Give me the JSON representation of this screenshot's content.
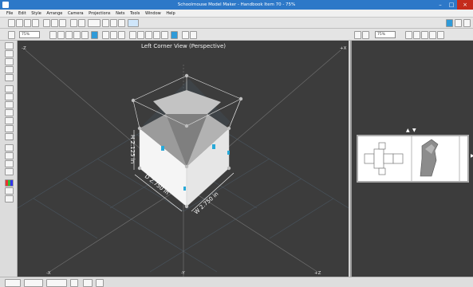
{
  "window": {
    "title": "Schoolmouse Model Maker - Handbook Item 70 - 75%"
  },
  "menu": [
    "File",
    "Edit",
    "Style",
    "Arrange",
    "Camera",
    "Projections",
    "Nets",
    "Tools",
    "Window",
    "Help"
  ],
  "toolbar": {
    "zoom_left": "75%",
    "zoom_right": "75%"
  },
  "viewport": {
    "view_title": "Left Corner View (Perspective)",
    "axis_labels": {
      "top_left": "-Z",
      "top_right": "+X",
      "bottom_left": "-X",
      "bottom_center": "-Y",
      "bottom_right": "+Z"
    },
    "dimensions": {
      "height": "H 2.125 in",
      "depth": "D 2.750 in",
      "width": "W 2.750 in"
    }
  },
  "colors": {
    "titlebar": "#2d78c8",
    "viewport_bg": "#3c3c3c",
    "accent_marker": "#29a9d8",
    "close_button": "#c42b1c"
  },
  "icons": [
    "app-icon",
    "minimize-icon",
    "maximize-icon",
    "close-icon",
    "new-icon",
    "open-icon",
    "save-icon",
    "print-icon",
    "cut-icon",
    "copy-icon",
    "paste-icon",
    "undo-icon",
    "redo-icon",
    "zoom-in-icon",
    "zoom-out-icon",
    "rotate-icon",
    "select-icon",
    "pencil-icon",
    "line-icon",
    "rectangle-icon",
    "circle-icon",
    "text-icon",
    "palette-icon"
  ]
}
